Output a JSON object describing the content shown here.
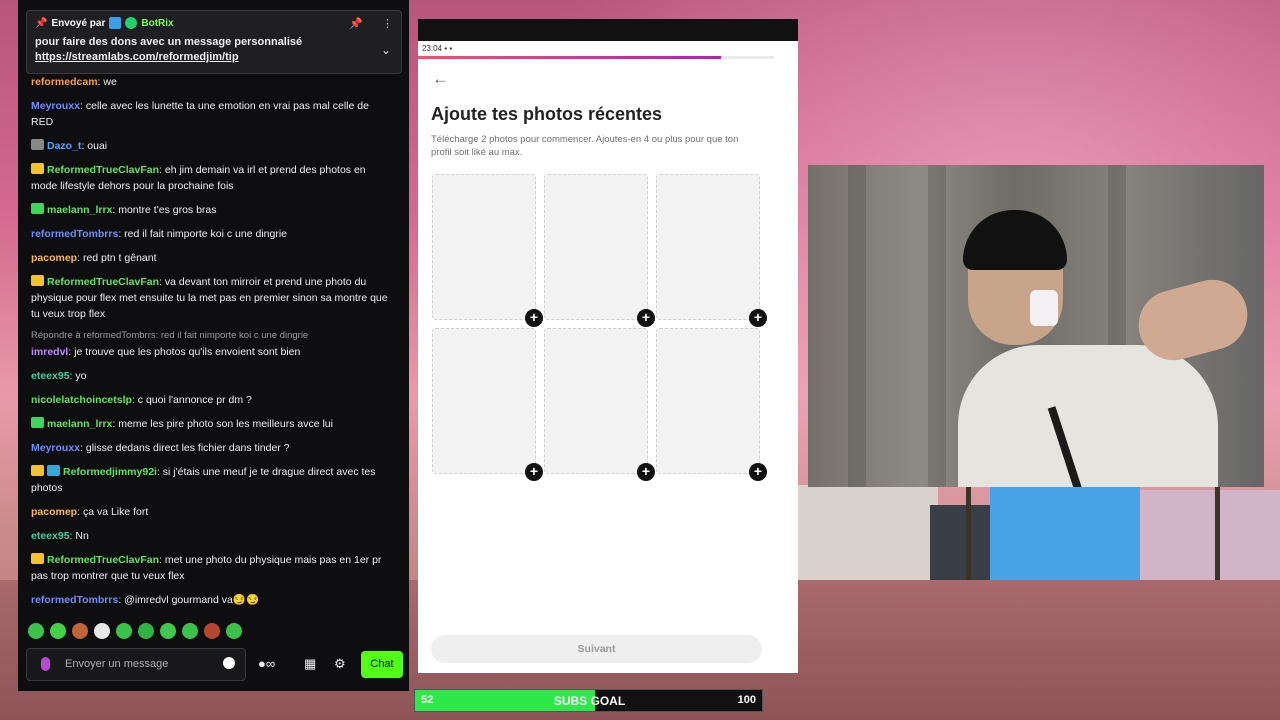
{
  "pinned": {
    "sent_by_label": "Envoyé par",
    "bot_name": "BotRix",
    "text": "pour faire des dons avec un message personnalisé",
    "link": "https://streamlabs.com/reformedjim/tip"
  },
  "messages": [
    {
      "user": "reformedcam",
      "color": "#ff9f40",
      "text": ": we"
    },
    {
      "user": "Meyrouxx",
      "color": "#6f8cff",
      "text": ": celle avec les lunette ta une emotion en vrai pas mal celle de RED"
    },
    {
      "user": "Dazo_t",
      "color": "#4aa8ff",
      "text": ": ouai"
    },
    {
      "user": "ReformedTrueClavFan",
      "color": "#5ee65e",
      "text": ": eh jim demain va irl et prend des photos en mode lifestyle dehors pour la prochaine fois"
    },
    {
      "user": "maelann_lrrx",
      "color": "#5ee65e",
      "text": ": montre t'es gros bras"
    },
    {
      "user": "reformedTombrrs",
      "color": "#6f8cff",
      "text": ": red il fait nimporte koi c une dingrie"
    },
    {
      "user": "pacomep",
      "color": "#ffb84d",
      "text": ": red ptn t gênant"
    },
    {
      "user": "ReformedTrueClavFan",
      "color": "#5ee65e",
      "text": ": va devant ton mirroir et prend une photo du physique pour flex met ensuite tu la met pas en premier sinon sa montre que tu veux trop flex"
    },
    {
      "reply": "Répondre à reformedTombrrs: red il fait nimporte koi c une dingrie",
      "user": "imredvl",
      "color": "#c08bff",
      "text": ": je trouve que les photos qu'ils envoient sont bien"
    },
    {
      "user": "eteex95",
      "color": "#3fd0a0",
      "text": ": yo"
    },
    {
      "user": "nicolelatchoincetslp",
      "color": "#5ee65e",
      "text": ": c quoi l'annonce pr dm ?"
    },
    {
      "user": "maelann_lrrx",
      "color": "#5ee65e",
      "text": ": meme les pire photo son les meilleurs avce lui"
    },
    {
      "user": "Meyrouxx",
      "color": "#6f8cff",
      "text": ": glisse dedans direct les fichier dans tinder ?"
    },
    {
      "user": "Reformedjimmy92i",
      "color": "#5ee65e",
      "text": ": si j'étais une meuf je te drague direct avec tes photos"
    },
    {
      "user": "pacomep",
      "color": "#ffb84d",
      "text": ": ça va Like fort"
    },
    {
      "user": "eteex95",
      "color": "#3fd0a0",
      "text": ": Nn"
    },
    {
      "user": "ReformedTrueClavFan",
      "color": "#5ee65e",
      "text": ": met une photo du physique mais pas en 1er pr pas trop montrer que tu veux flex"
    },
    {
      "user": "reformedTombrrs",
      "color": "#6f8cff",
      "text": ": @imredvl gourmand va😏😏"
    }
  ],
  "chat_input": {
    "placeholder": "Envoyer un message",
    "send_label": "Chat"
  },
  "phone": {
    "status_time": "23:04",
    "progress": 0.85,
    "title": "Ajoute tes photos récentes",
    "subtitle": "Télécharge 2 photos pour commencer. Ajoutes-en 4 ou plus pour que ton profil soit liké au max.",
    "next_label": "Suivant"
  },
  "goal": {
    "current": "52",
    "label": "SUBS GOAL",
    "target": "100",
    "fraction": 0.52
  }
}
